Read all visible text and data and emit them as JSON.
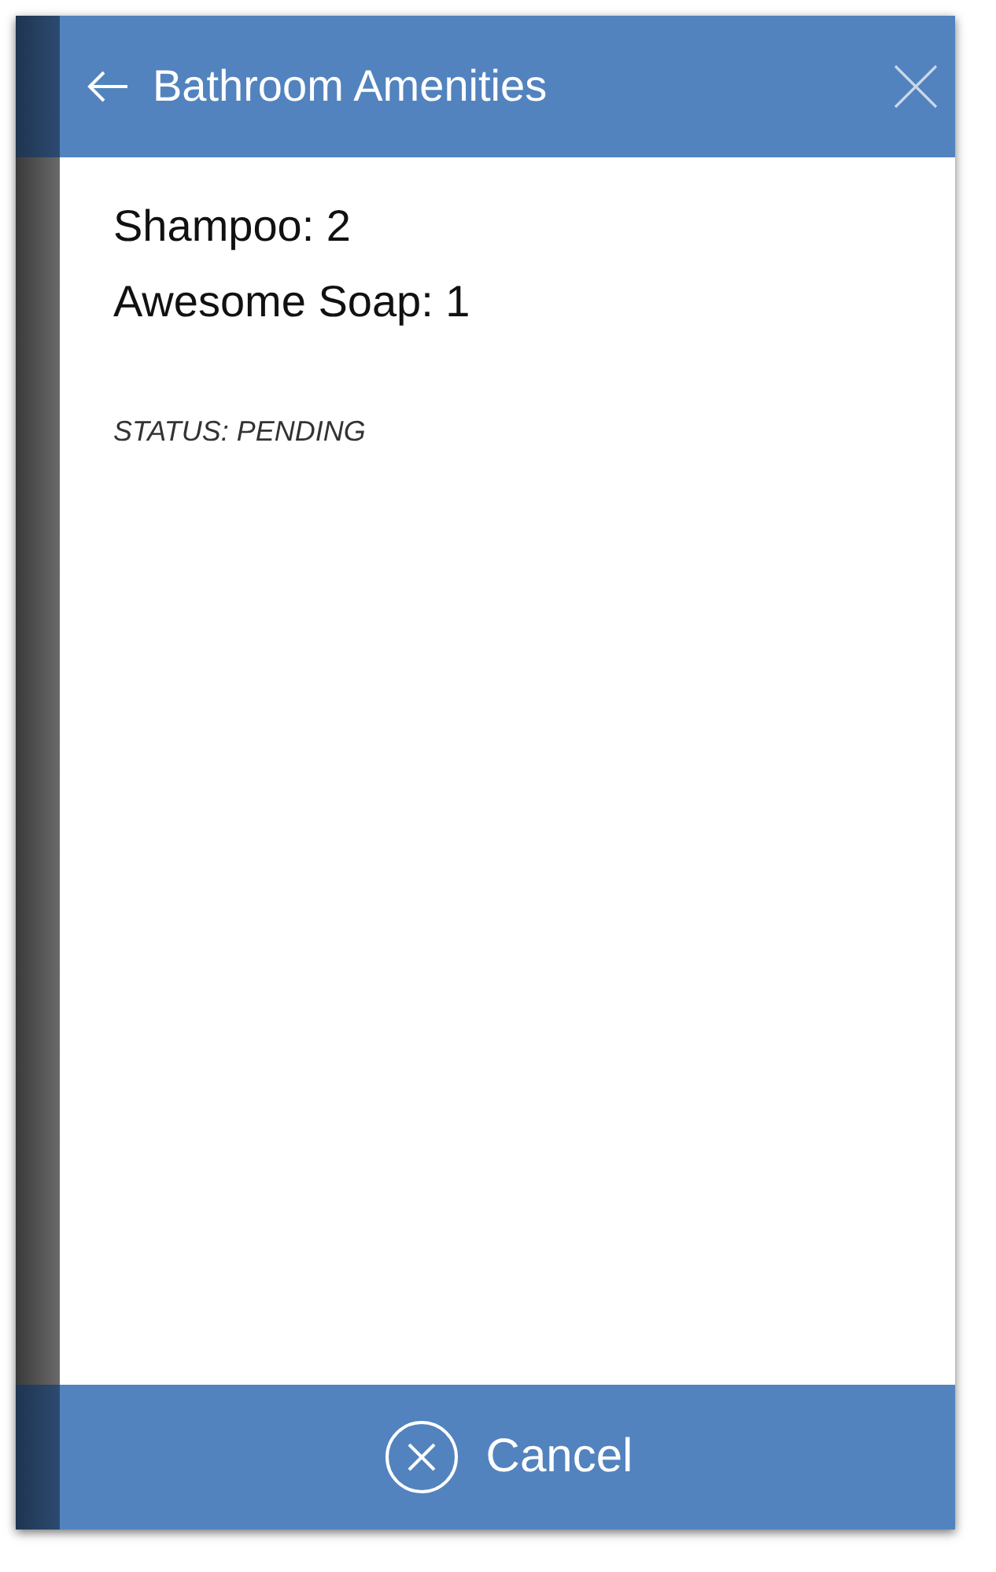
{
  "header": {
    "title": "Bathroom Amenities"
  },
  "items": [
    {
      "text": "Shampoo: 2"
    },
    {
      "text": "Awesome Soap: 1"
    }
  ],
  "status": "STATUS: PENDING",
  "footer": {
    "button": "Cancel"
  }
}
